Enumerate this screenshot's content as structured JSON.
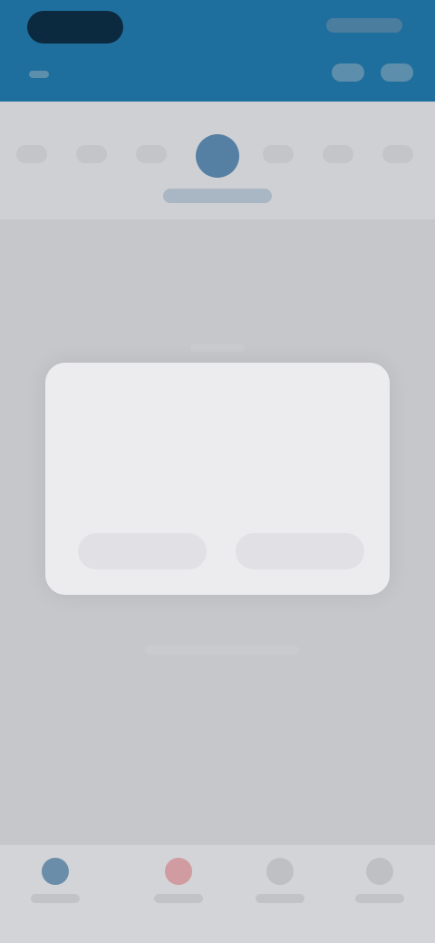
{
  "dialog": {
    "title": "",
    "message": "",
    "cancel_label": "",
    "confirm_label": ""
  },
  "top_tabs": [
    "",
    "",
    "",
    "",
    "",
    "",
    ""
  ],
  "bottom_nav": [
    "",
    "",
    "",
    ""
  ]
}
